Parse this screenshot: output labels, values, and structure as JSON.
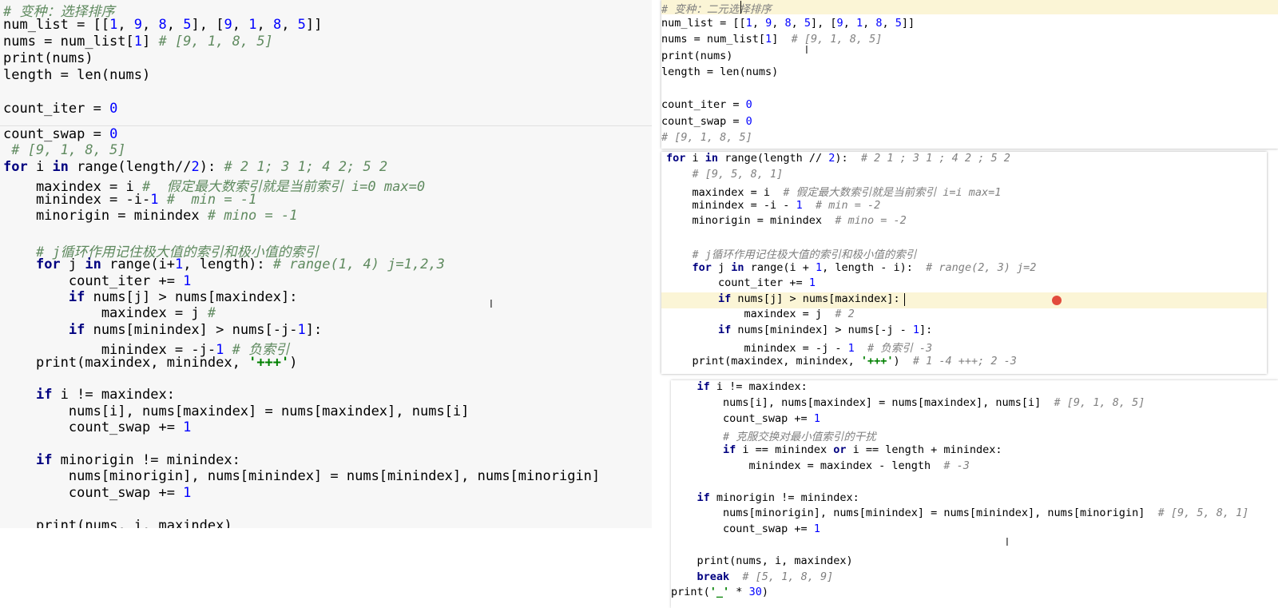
{
  "left_code_top": [
    "# 变种：选择排序",
    "num_list = [[1, 9, 8, 5], [9, 1, 8, 5]]",
    "nums = num_list[1] # [9, 1, 8, 5]",
    "print(nums)",
    "length = len(nums)",
    "",
    "count_iter = 0"
  ],
  "left_code_bottom": [
    "count_swap = 0",
    " # [9, 1, 8, 5]",
    "for i in range(length//2): # 2 1; 3 1; 4 2; 5 2",
    "    maxindex = i #  假定最大数索引就是当前索引 i=0 max=0",
    "    minindex = -i-1 #  min = -1",
    "    minorigin = minindex # mino = -1",
    "",
    "    # j循环作用记住极大值的索引和极小值的索引",
    "    for j in range(i+1, length): # range(1, 4) j=1,2,3",
    "        count_iter += 1",
    "        if nums[j] > nums[maxindex]:",
    "            maxindex = j #",
    "        if nums[minindex] > nums[-j-1]:",
    "            minindex = -j-1 # 负索引",
    "    print(maxindex, minindex, '+++')",
    "",
    "    if i != maxindex:",
    "        nums[i], nums[maxindex] = nums[maxindex], nums[i]",
    "        count_swap += 1",
    "",
    "    if minorigin != minindex:",
    "        nums[minorigin], nums[minindex] = nums[minindex], nums[minorigin]",
    "        count_swap += 1",
    "",
    "    print(nums, i, maxindex)"
  ],
  "right_code_p1": [
    "# 变种：二元选择排序",
    "num_list = [[1, 9, 8, 5], [9, 1, 8, 5]]",
    "nums = num_list[1]  # [9, 1, 8, 5]",
    "print(nums)",
    "length = len(nums)",
    "",
    "count_iter = 0",
    "count_swap = 0",
    "# [9, 1, 8, 5]"
  ],
  "right_code_p2": [
    "for i in range(length // 2):  # 2 1 ; 3 1 ; 4 2 ; 5 2",
    "    # [9, 5, 8, 1]",
    "    maxindex = i  # 假定最大数索引就是当前索引 i=i max=1",
    "    minindex = -i - 1  # min = -2",
    "    minorigin = minindex  # mino = -2",
    "",
    "    # j循环作用记住极大值的索引和极小值的索引",
    "    for j in range(i + 1, length - i):  # range(2, 3) j=2",
    "        count_iter += 1",
    "        if nums[j] > nums[maxindex]:",
    "            maxindex = j  # 2",
    "        if nums[minindex] > nums[-j - 1]:",
    "            minindex = -j - 1  # 负索引 -3",
    "    print(maxindex, minindex, '+++')  # 1 -4 +++; 2 -3"
  ],
  "right_code_p3": [
    "    if i != maxindex:",
    "        nums[i], nums[maxindex] = nums[maxindex], nums[i]  # [9, 1, 8, 5]",
    "        count_swap += 1",
    "        # 克服交换对最小值索引的干扰",
    "        if i == minindex or i == length + minindex:",
    "            minindex = maxindex - length  # -3",
    "",
    "    if minorigin != minindex:",
    "        nums[minorigin], nums[minindex] = nums[minindex], nums[minorigin]  # [9, 5, 8, 1]",
    "        count_swap += 1",
    "",
    "    print(nums, i, maxindex)",
    "    break  # [5, 1, 8, 9]",
    "print('_' * 30)"
  ],
  "colors": {
    "keyword": "#000080",
    "comment": "#808080",
    "number": "#0000ff",
    "string": "#008000",
    "line_highlight": "#fbf5d6",
    "breakpoint": "#e24b3c"
  }
}
